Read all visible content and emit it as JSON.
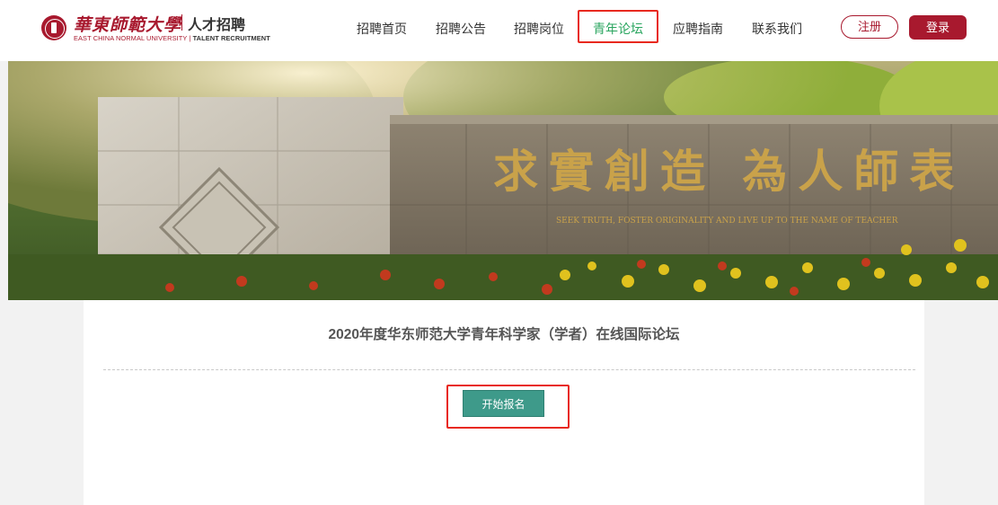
{
  "header": {
    "logo": {
      "name_cn": "華東師範大學",
      "subtitle": "人才招聘",
      "name_en": "EAST CHINA NORMAL UNIVERSITY",
      "subtitle_en": "TALENT RECRUITMENT"
    },
    "nav": [
      {
        "label": "招聘首页",
        "active": false
      },
      {
        "label": "招聘公告",
        "active": false
      },
      {
        "label": "招聘岗位",
        "active": false
      },
      {
        "label": "青年论坛",
        "active": true
      },
      {
        "label": "应聘指南",
        "active": false
      },
      {
        "label": "联系我们",
        "active": false
      }
    ],
    "register_label": "注册",
    "login_label": "登录"
  },
  "banner": {
    "wall_text_cn": "求實創造 為人師表",
    "wall_text_en": "SEEK TRUTH, FOSTER ORIGINALITY AND LIVE UP TO THE NAME OF TEACHER"
  },
  "forum": {
    "title": "2020年度华东师范大学青年科学家（学者）在线国际论坛",
    "start_button_label": "开始报名"
  },
  "colors": {
    "brand": "#a8192e",
    "active_nav": "#2aa55f",
    "button": "#3e9a8a",
    "highlight": "#e8291f"
  }
}
